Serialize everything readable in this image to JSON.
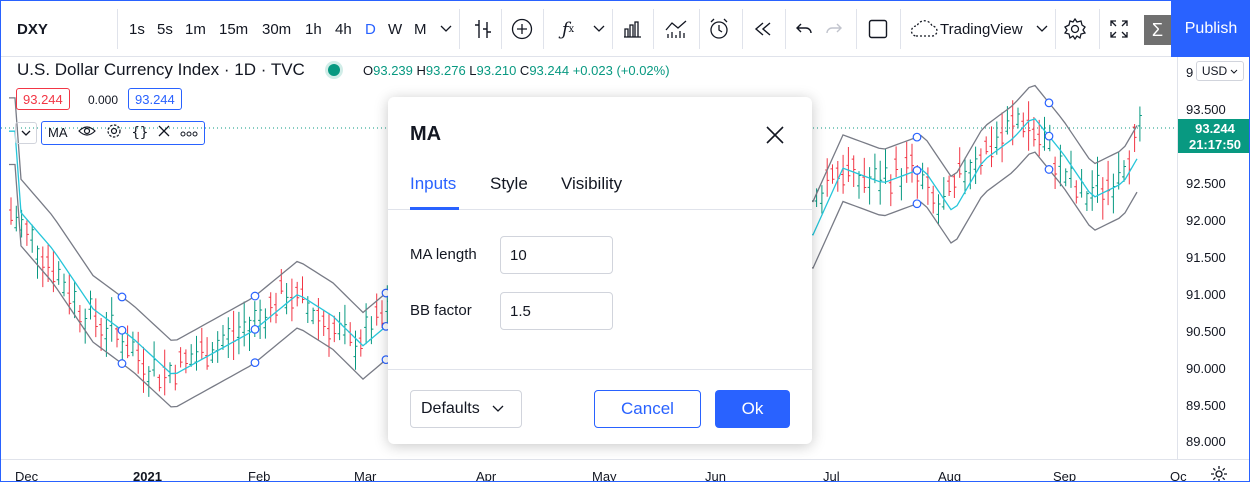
{
  "toolbar": {
    "symbol": "DXY",
    "intervals": [
      "1s",
      "5s",
      "1m",
      "15m",
      "30m",
      "1h",
      "4h",
      "D",
      "W",
      "M"
    ],
    "active_interval": "D",
    "layout_name": "TradingView",
    "publish_label": "Publish"
  },
  "legend": {
    "title": "U.S. Dollar Currency Index · 1D · TVC",
    "open_label": "O",
    "open": "93.239",
    "high_label": "H",
    "high": "93.276",
    "low_label": "L",
    "low": "93.210",
    "close_label": "C",
    "close": "93.244",
    "change": "+0.023 (+0.02%)",
    "bid": "93.244",
    "spread": "0.000",
    "ask": "93.244",
    "indicator_name": "MA"
  },
  "price_axis": {
    "currency": "USD",
    "top_fragment": "9",
    "labels": [
      "93.500",
      "92.500",
      "92.000",
      "91.500",
      "91.000",
      "90.500",
      "90.000",
      "89.500",
      "89.000"
    ],
    "last_price": "93.244",
    "countdown": "21:17:50"
  },
  "time_axis": {
    "labels": [
      "Dec",
      "2021",
      "Feb",
      "Mar",
      "Apr",
      "May",
      "Jun",
      "Jul",
      "Aug",
      "Sep",
      "Oc"
    ]
  },
  "dialog": {
    "title": "MA",
    "tabs": [
      "Inputs",
      "Style",
      "Visibility"
    ],
    "active_tab": "Inputs",
    "fields": [
      {
        "label": "MA length",
        "value": "10"
      },
      {
        "label": "BB factor",
        "value": "1.5"
      }
    ],
    "defaults_label": "Defaults",
    "cancel_label": "Cancel",
    "ok_label": "Ok"
  },
  "colors": {
    "accent": "#2962ff",
    "up": "#089981",
    "down": "#f23645",
    "ma_line": "#26c6da",
    "bands": "#787b86"
  }
}
